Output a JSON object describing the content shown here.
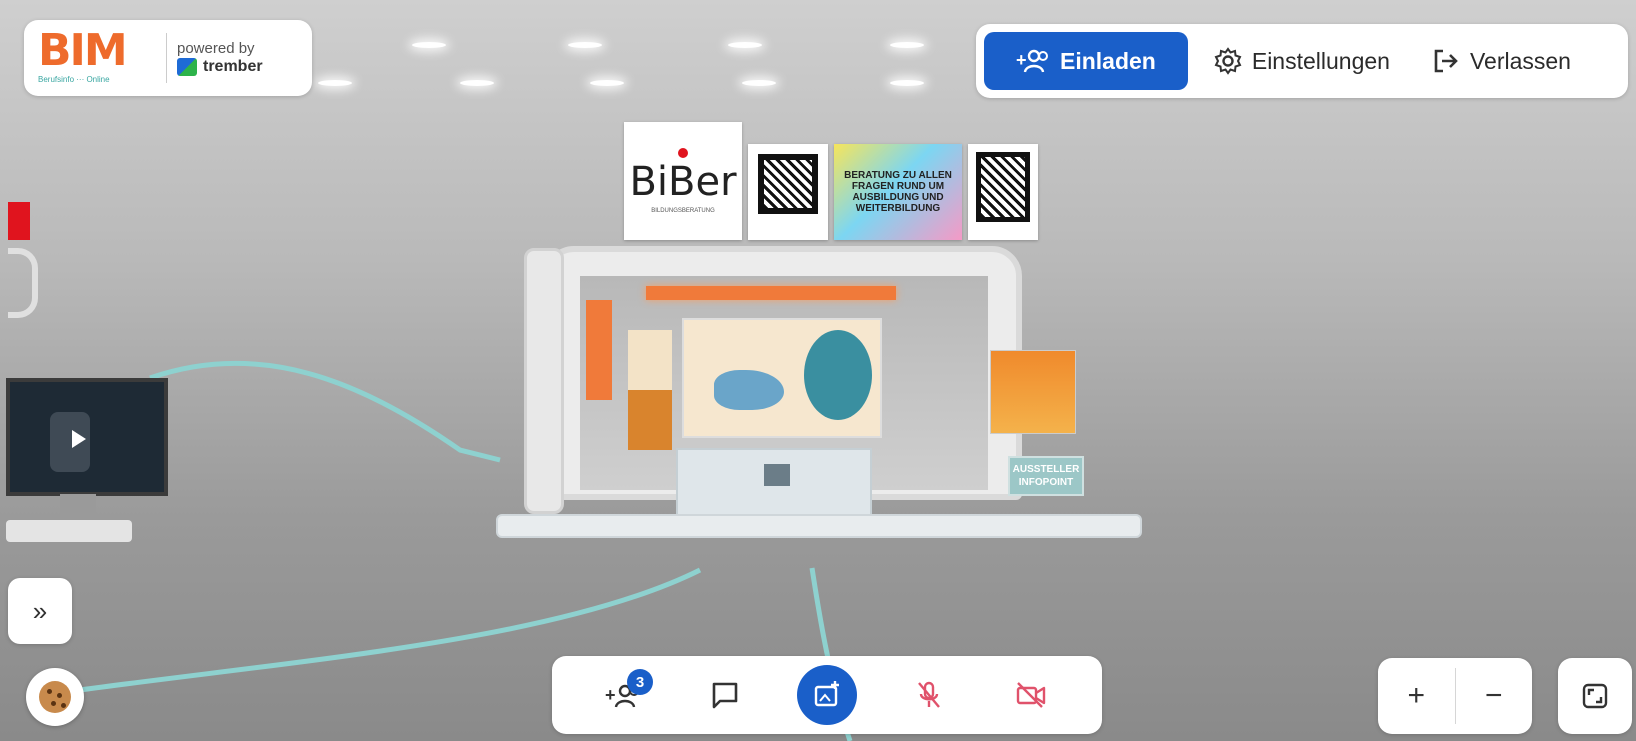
{
  "logo": {
    "brand_text": "BIM",
    "brand_sub": "Berufsinfo ··· Online",
    "powered_by": "powered by",
    "partner": "trember"
  },
  "top_nav": {
    "invite_label": "Einladen",
    "settings_label": "Einstellungen",
    "leave_label": "Verlassen"
  },
  "booth": {
    "logo_text": "BiBer",
    "logo_sub": "BILDUNGSBERATUNG",
    "banner_text": "BERATUNG ZU ALLEN FRAGEN RUND UM AUSBILDUNG UND WEITERBILDUNG",
    "infopoint_label": "AUSSTELLER INFOPOINT"
  },
  "participants": {
    "count": "3"
  },
  "colors": {
    "accent": "#1a5fc9",
    "muted_red": "#e0526b",
    "brand_orange": "#ee6b2c",
    "teal": "#3aa7a2"
  },
  "icons": {
    "invite": "add-people-icon",
    "settings": "gear-icon",
    "leave": "exit-icon",
    "chat": "chat-icon",
    "share": "share-screen-icon",
    "mic": "mic-off-icon",
    "camera": "camera-off-icon",
    "zoom_in": "plus-icon",
    "zoom_out": "minus-icon",
    "fullscreen": "fullscreen-icon",
    "expand": "double-chevron-right-icon",
    "cookie": "cookie-icon"
  },
  "zoom": {
    "in_label": "+",
    "out_label": "−"
  },
  "sidebar": {
    "expand_label": "»"
  }
}
